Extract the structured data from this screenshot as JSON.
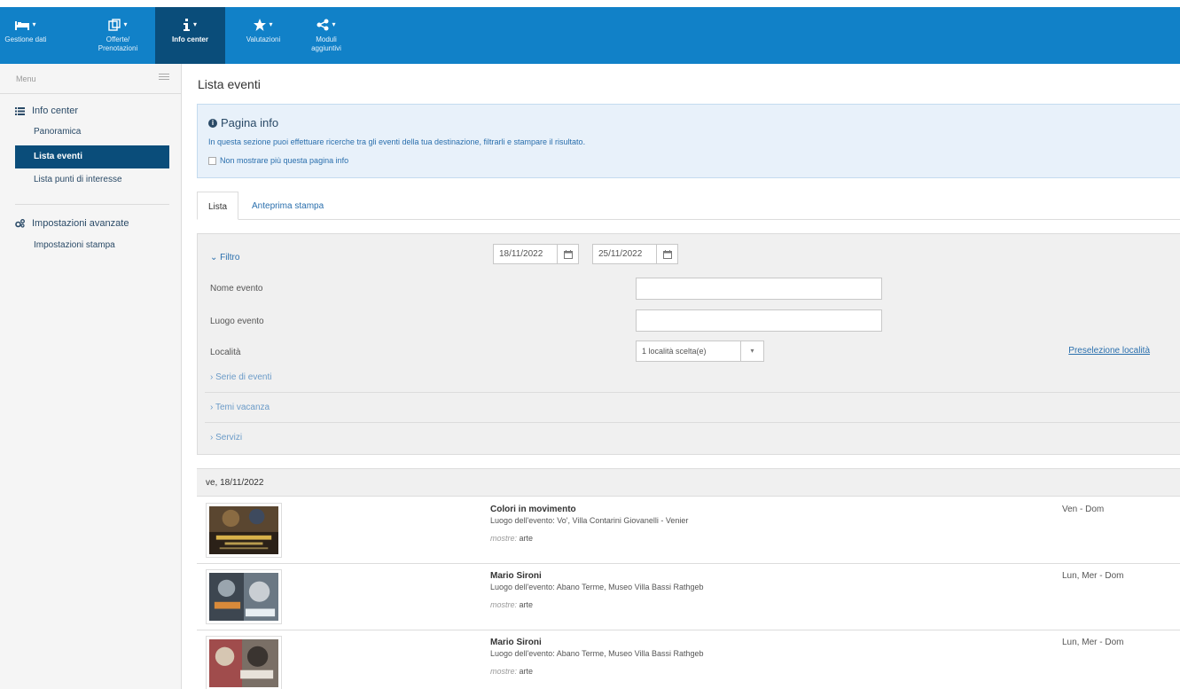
{
  "nav": {
    "items": [
      {
        "label": "Gestione dati",
        "icon": "bed-icon"
      },
      {
        "label": "Offerte/\nPrenotazioni",
        "icon": "calendar-offer-icon"
      },
      {
        "label": "Info center",
        "icon": "info-icon"
      },
      {
        "label": "Valutazioni",
        "icon": "star-icon"
      },
      {
        "label": "Moduli aggiuntivi",
        "icon": "share-icon"
      }
    ],
    "active": "Info center"
  },
  "sidebar": {
    "menu_label": "Menu",
    "section1": "Info center",
    "items": [
      "Panoramica",
      "Lista eventi",
      "Lista punti di interesse"
    ],
    "section2": "Impostazioni avanzate",
    "items2": [
      "Impostazioni stampa"
    ]
  },
  "page": {
    "title": "Lista eventi"
  },
  "info": {
    "title": "Pagina info",
    "text": "In questa sezione puoi effettuare ricerche tra gli eventi della tua destinazione, filtrarli e stampare il risultato.",
    "checkbox_label": "Non mostrare più questa pagina info"
  },
  "tabs": [
    "Lista",
    "Anteprima stampa"
  ],
  "filter": {
    "toggle_label": "Filtro",
    "date_from": "18/11/2022",
    "date_to": "25/11/2022",
    "name_label": "Nome evento",
    "place_label": "Luogo evento",
    "locality_label": "Località",
    "locality_value": "1 località scelta(e)",
    "preselect_link": "Preselezione località",
    "collapsibles": [
      "Serie di eventi",
      "Temi vacanza",
      "Servizi"
    ]
  },
  "events": {
    "date_header": "ve, 18/11/2022",
    "list": [
      {
        "title": "Colori in movimento",
        "place": "Luogo dell'evento: Vo', Villa Contarini Giovanelli - Venier",
        "cat_label": "mostre:",
        "cat_value": "arte",
        "days": "Ven - Dom"
      },
      {
        "title": "Mario Sironi",
        "place": "Luogo dell'evento: Abano Terme, Museo Villa Bassi Rathgeb",
        "cat_label": "mostre:",
        "cat_value": "arte",
        "days": "Lun, Mer - Dom"
      },
      {
        "title": "Mario Sironi",
        "place": "Luogo dell'evento: Abano Terme, Museo Villa Bassi Rathgeb",
        "cat_label": "mostre:",
        "cat_value": "arte",
        "days": "Lun, Mer - Dom"
      }
    ]
  },
  "colors": {
    "brand_blue": "#1181c8",
    "active_nav": "#0a4d7a",
    "link": "#2a6fad"
  }
}
